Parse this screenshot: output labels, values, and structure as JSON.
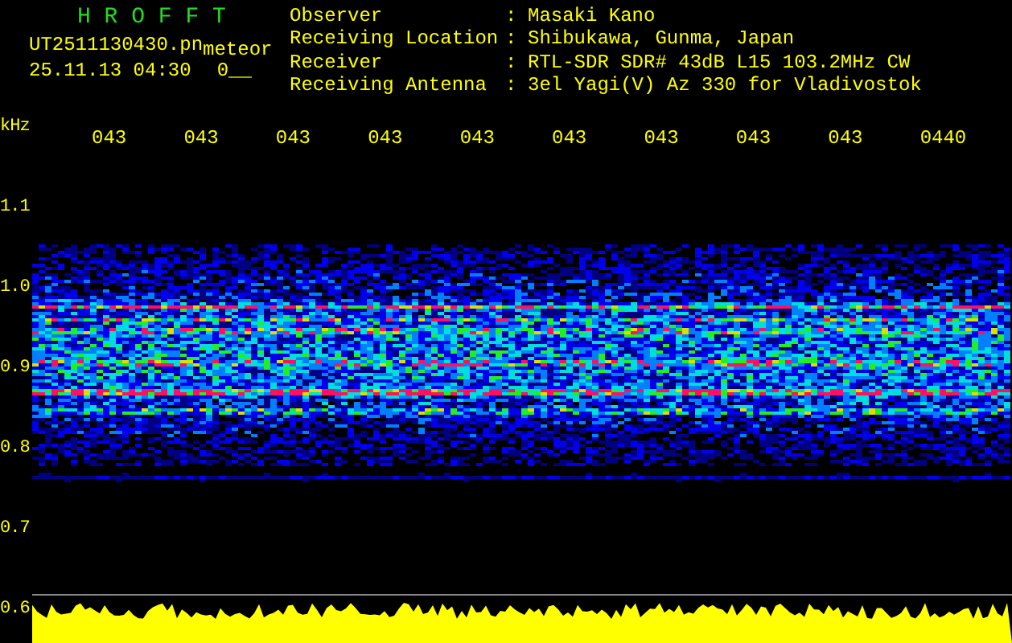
{
  "app_title": "H R O F F T",
  "file_name": "UT2511130430.pn",
  "mode": "meteor",
  "timestamp": "25.11.13 04:30",
  "count": "0__",
  "station_info": [
    {
      "label": "Observer",
      "separator": ":",
      "value": "Masaki Kano"
    },
    {
      "label": "Receiving Location",
      "separator": ":",
      "value": "Shibukawa, Gunma, Japan"
    },
    {
      "label": "Receiver",
      "separator": ":",
      "value": "RTL-SDR SDR# 43dB L15 103.2MHz CW"
    },
    {
      "label": "Receiving Antenna",
      "separator": ":",
      "value": "3el Yagi(V) Az 330 for Vladivostok"
    }
  ],
  "y_axis": {
    "unit": "kHz",
    "labels": [
      "1.1",
      "1.0",
      "0.9",
      "0.8",
      "0.7",
      "0.6"
    ]
  },
  "time_labels": [
    "043",
    "043",
    "043",
    "043",
    "043",
    "043",
    "043",
    "043",
    "043",
    "0440"
  ]
}
